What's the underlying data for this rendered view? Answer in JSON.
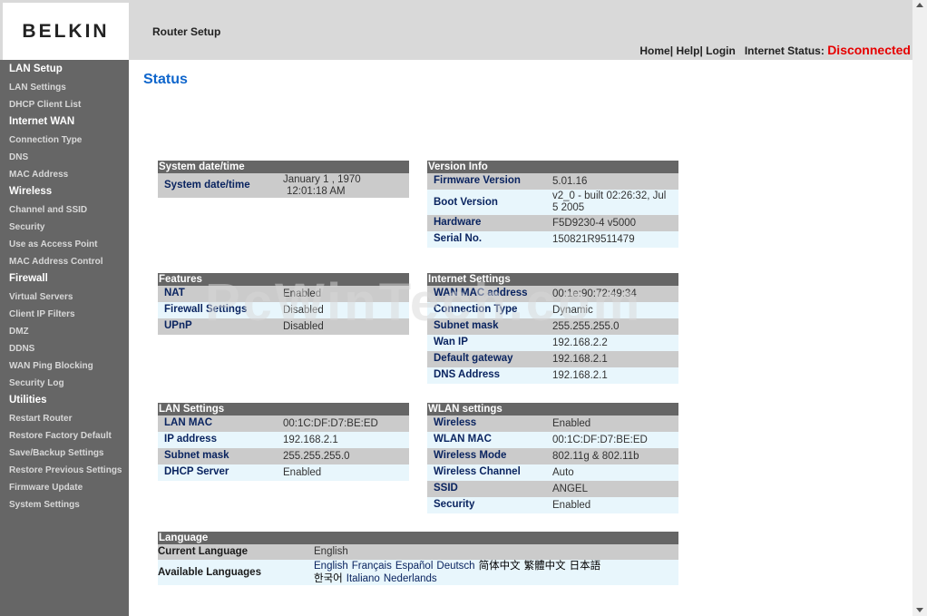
{
  "header": {
    "logo": "BELKIN",
    "title": "Router Setup",
    "nav": {
      "home": "Home",
      "help": "Help",
      "login": "Login"
    },
    "internet_status_label": "Internet Status:",
    "internet_status_value": "Disconnected"
  },
  "sidebar": {
    "sections": [
      {
        "label": "LAN Setup",
        "items": [
          "LAN Settings",
          "DHCP Client List"
        ]
      },
      {
        "label": "Internet WAN",
        "items": [
          "Connection Type",
          "DNS",
          "MAC Address"
        ]
      },
      {
        "label": "Wireless",
        "items": [
          "Channel and SSID",
          "Security",
          "Use as Access Point",
          "MAC Address Control"
        ]
      },
      {
        "label": "Firewall",
        "items": [
          "Virtual Servers",
          "Client IP Filters",
          "DMZ",
          "DDNS",
          "WAN Ping Blocking",
          "Security Log"
        ]
      },
      {
        "label": "Utilities",
        "items": [
          "Restart Router",
          "Restore Factory Default",
          "Save/Backup Settings",
          "Restore Previous Settings",
          "Firmware Update",
          "System Settings"
        ]
      }
    ]
  },
  "page": {
    "title": "Status",
    "watermark": "PcWinTech.com"
  },
  "system_datetime": {
    "heading": "System date/time",
    "label": "System date/time",
    "value_line1": "January 1 , 1970",
    "value_line2": "12:01:18 AM"
  },
  "version_info": {
    "heading": "Version Info",
    "rows": [
      {
        "label": "Firmware Version",
        "value": "5.01.16"
      },
      {
        "label": "Boot Version",
        "value": "v2_0 - built 02:26:32, Jul 5 2005"
      },
      {
        "label": "Hardware",
        "value": "F5D9230-4 v5000"
      },
      {
        "label": "Serial No.",
        "value": "150821R9511479"
      }
    ]
  },
  "features": {
    "heading": "Features",
    "rows": [
      {
        "label": "NAT",
        "value": "Enabled"
      },
      {
        "label": "Firewall Settings",
        "value": "Disabled"
      },
      {
        "label": "UPnP",
        "value": "Disabled"
      }
    ]
  },
  "internet_settings": {
    "heading": "Internet Settings",
    "rows": [
      {
        "label": "WAN MAC address",
        "value": "00:1e:90:72:49:34"
      },
      {
        "label": "Connection Type",
        "value": "Dynamic"
      },
      {
        "label": "Subnet mask",
        "value": "255.255.255.0"
      },
      {
        "label": "Wan IP",
        "value": "192.168.2.2"
      },
      {
        "label": "Default gateway",
        "value": "192.168.2.1"
      },
      {
        "label": "DNS Address",
        "value": "192.168.2.1"
      }
    ]
  },
  "lan_settings": {
    "heading": "LAN Settings",
    "rows": [
      {
        "label": "LAN MAC",
        "value": "00:1C:DF:D7:BE:ED"
      },
      {
        "label": "IP address",
        "value": "192.168.2.1"
      },
      {
        "label": "Subnet mask",
        "value": "255.255.255.0"
      },
      {
        "label": "DHCP Server",
        "value": "Enabled"
      }
    ]
  },
  "wlan_settings": {
    "heading": "WLAN settings",
    "rows": [
      {
        "label": "Wireless",
        "value": "Enabled"
      },
      {
        "label": "WLAN MAC",
        "value": "00:1C:DF:D7:BE:ED"
      },
      {
        "label": "Wireless Mode",
        "value": "802.11g & 802.11b"
      },
      {
        "label": "Wireless Channel",
        "value": "Auto"
      },
      {
        "label": "SSID",
        "value": "ANGEL"
      },
      {
        "label": "Security",
        "value": "Enabled"
      }
    ]
  },
  "language": {
    "heading": "Language",
    "current_label": "Current Language",
    "current_value": "English",
    "available_label": "Available Languages",
    "languages": [
      "English",
      "Français",
      "Español",
      "Deutsch",
      "简体中文",
      "繁體中文",
      "日本語",
      "한국어",
      "Italiano",
      "Nederlands"
    ]
  }
}
